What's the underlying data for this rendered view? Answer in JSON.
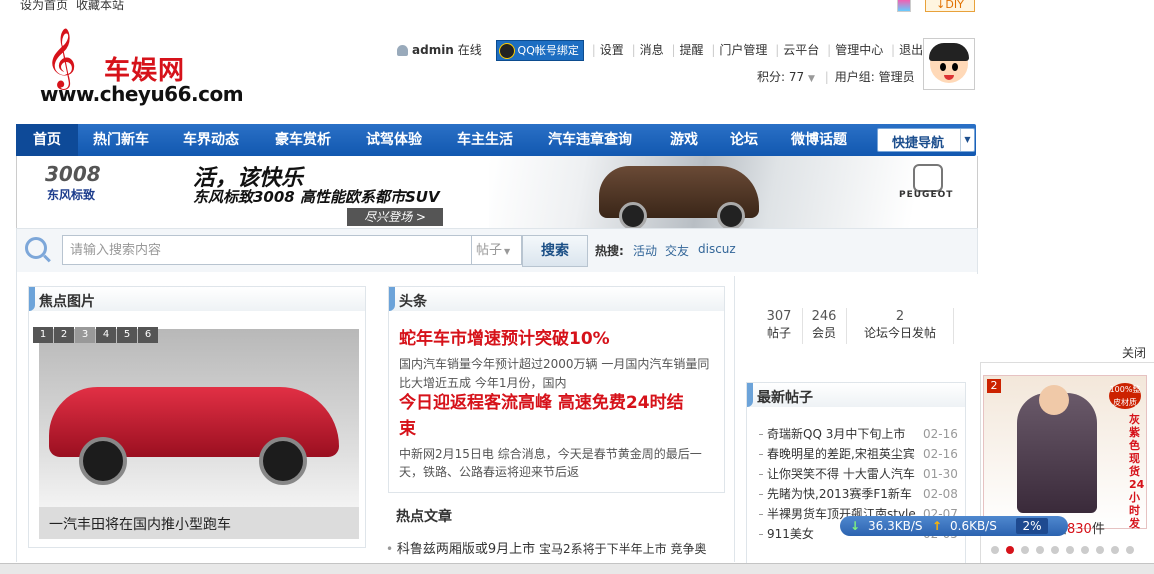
{
  "top": {
    "links": [
      "设为首页",
      "收藏本站"
    ],
    "diy": "↓DIY"
  },
  "logo": {
    "cn": "车娱网",
    "url": "www.cheyu66.com"
  },
  "user": {
    "name": "admin",
    "status": "在线",
    "qq": "QQ帐号绑定",
    "menu": [
      "设置",
      "消息",
      "提醒",
      "门户管理",
      "云平台",
      "管理中心",
      "退出"
    ],
    "points_label": "积分: 77",
    "group_label": "用户组: 管理员"
  },
  "nav": {
    "items": [
      "首页",
      "热门新车",
      "车界动态",
      "豪车赏析",
      "试驾体验",
      "车主生活",
      "汽车违章查询",
      "游戏",
      "论坛",
      "微博话题"
    ],
    "quick": "快捷导航"
  },
  "banner": {
    "model": "3008",
    "brand": "东风标致",
    "slogan": "活，该快乐",
    "sub": "东风标致3008 高性能欧系都市SUV",
    "btn": "尽兴登场 >",
    "peugeot": "PEUGEOT"
  },
  "search": {
    "placeholder": "请输入搜索内容",
    "scope": "帖子",
    "button": "搜索",
    "hot_label": "热搜:",
    "hot": [
      "活动",
      "交友",
      "discuz"
    ]
  },
  "focus": {
    "title": "焦点图片",
    "pages": [
      "1",
      "2",
      "3",
      "4",
      "5",
      "6"
    ],
    "caption": "一汽丰田将在国内推小型跑车"
  },
  "headlines": {
    "title": "头条",
    "h1": "蛇年车市增速预计突破10%",
    "p1a": "国内汽车销量今年预计超过2000万辆 一月国内汽车销量同",
    "p1b": "比大增近五成 今年1月份，国内",
    "h2a": "今日迎返程客流高峰 高速免费24时结",
    "h2b": "束",
    "p2a": "中新网2月15日电 综合消息，今天是春节黄金周的最后一",
    "p2b": "天，铁路、公路春运将迎来节后返"
  },
  "hot_articles": {
    "title": "热点文章",
    "first_big": "科鲁兹两厢版或9月上市",
    "first_rest": "宝马2系将于下半年上市 竞争奥"
  },
  "stats": [
    {
      "n": "307",
      "l": "帖子"
    },
    {
      "n": "246",
      "l": "会员"
    },
    {
      "n": "2",
      "l": "论坛今日发帖"
    }
  ],
  "latest": {
    "title": "最新帖子",
    "rows": [
      {
        "t": "奇瑞新QQ 3月中下旬上市",
        "d": "02-16"
      },
      {
        "t": "春晚明星的差距,宋祖英尘宾",
        "d": "02-16"
      },
      {
        "t": "让你哭笑不得 十大雷人汽车",
        "d": "01-30"
      },
      {
        "t": "先睹为快,2013赛季F1新车",
        "d": "02-08"
      },
      {
        "t": "半裸男货车顶开飙江南style",
        "d": "02-07"
      },
      {
        "t": "911美女",
        "d": "02-05"
      }
    ]
  },
  "ad": {
    "num": "2",
    "badge": "100%整皮材质",
    "vertical": "灰紫色现货24小时发",
    "sold_pre": "售出",
    "sold_num": "830",
    "sold_suf": "件",
    "close": "关闭"
  },
  "speed": {
    "down": "36.3KB/S",
    "up": "0.6KB/S",
    "pct": "2%"
  },
  "colors": {
    "nav": "#1258b0",
    "accent_red": "#d6121a",
    "link": "#336699"
  }
}
